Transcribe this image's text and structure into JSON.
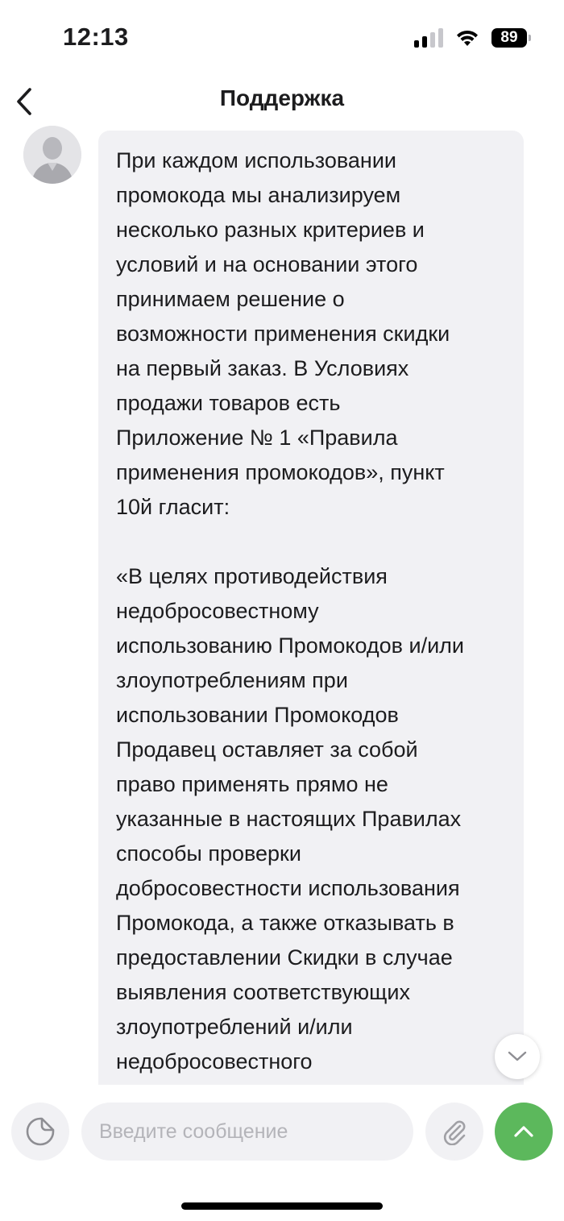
{
  "status_bar": {
    "time": "12:13",
    "battery_level": "89"
  },
  "header": {
    "title": "Поддержка"
  },
  "message": {
    "text": "При каждом использовании\nпромокода мы анализируем\nнесколько разных критериев и\nусловий и на основании этого\nпринимаем решение о\nвозможности применения скидки\nна первый заказ. В Условиях\nпродажи товаров есть\nПриложение № 1 «Правила\nприменения промокодов», пункт\n10й гласит:\n\n«В целях противодействия\nнедобросовестному\nиспользованию Промокодов и/или\nзлоупотреблениям при\nиспользовании Промокодов\nПродавец оставляет за собой\nправо применять прямо не\nуказанные в настоящих Правилах\nспособы проверки\nдобросовестности использования\nПромокода, а также отказывать в\nпредоставлении Скидки в случае\nвыявления соответствующих\nзлоупотреблений и/или\nнедобросовестного"
  },
  "composer": {
    "placeholder": "Введите сообщение"
  },
  "colors": {
    "accent_green": "#5cb85c",
    "bubble_bg": "#f1f1f4"
  }
}
